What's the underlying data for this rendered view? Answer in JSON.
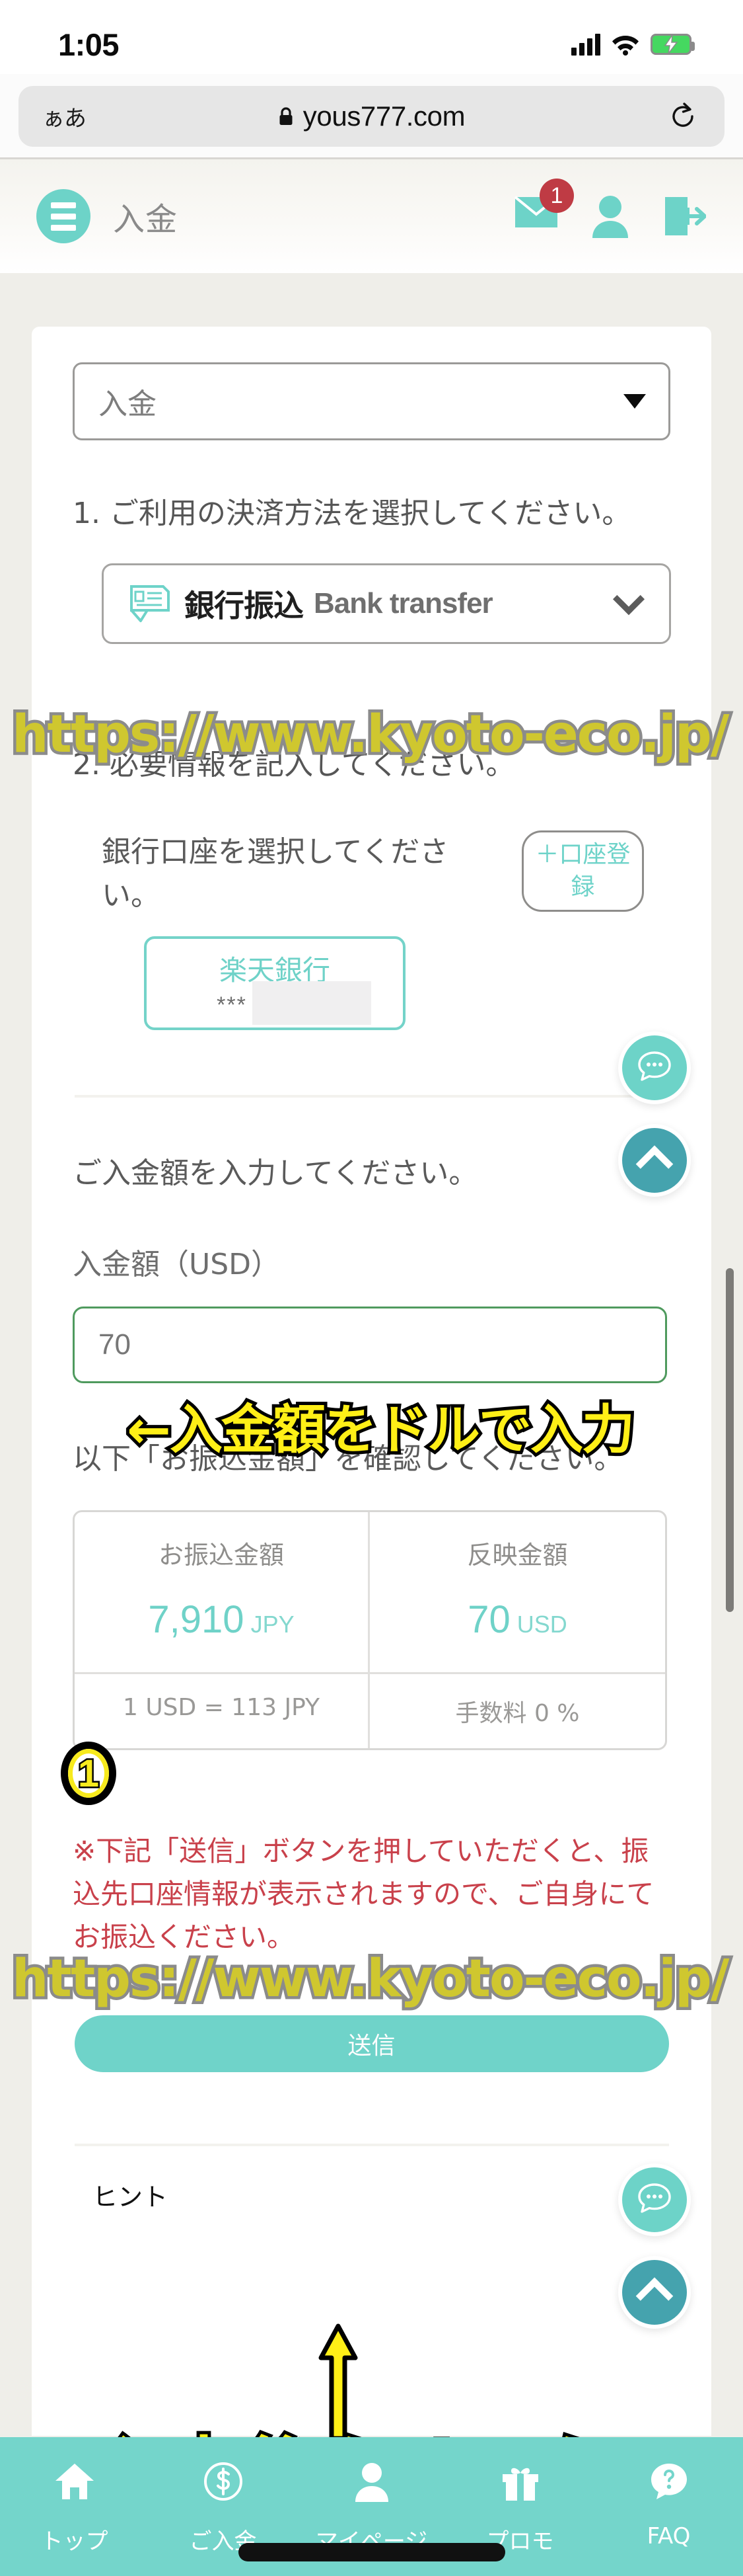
{
  "status_bar": {
    "time": "1:05",
    "signal_icon": "cellular-signal-icon",
    "wifi_icon": "wifi-icon",
    "battery_icon": "battery-charging-icon"
  },
  "browser": {
    "text_size_button": "ぁあ",
    "lock_icon": "lock-icon",
    "url": "yous777.com",
    "reload_icon": "reload-icon"
  },
  "app_header": {
    "menu_icon": "hamburger-menu-icon",
    "title": "入金",
    "mail_icon": "mail-icon",
    "mail_badge": "1",
    "profile_icon": "user-profile-icon",
    "logout_icon": "logout-icon"
  },
  "page": {
    "select_value": "入金",
    "step1_title": "1. ご利用の決済方法を選択してください。",
    "payment_method": {
      "icon": "bank-transfer-icon",
      "label_ja": "銀行振込",
      "label_en": "Bank transfer",
      "chevron_icon": "chevron-down-icon"
    },
    "step2_title": "2. 必要情報を記入してください。",
    "bank_select_label": "銀行口座を選択してください。",
    "register_account_button": "＋口座登録",
    "bank_card": {
      "name": "楽天銀行",
      "masked": "***"
    },
    "amount_prompt": "ご入金額を入力してください。",
    "amount_label": "入金額（USD）",
    "amount_value": "70",
    "confirm_text": "以下「お振込金額」を確認してください。",
    "warning_text": "※下記「送信」ボタンを押していただくと、振込先口座情報が表示されますので、ご自身にてお振込ください。",
    "submit_button": "送信",
    "hint_label": "ヒント"
  },
  "amount_table": {
    "headers": [
      "お振込金額",
      "反映金額"
    ],
    "values": [
      {
        "amount": "7,910",
        "currency": "JPY"
      },
      {
        "amount": "70",
        "currency": "USD"
      }
    ],
    "footer": [
      "1 USD = 113 JPY",
      "手数料 0 %"
    ]
  },
  "floating_buttons": {
    "chat_icon": "chat-bubble-icon",
    "scroll_top_icon": "chevron-up-icon"
  },
  "annotations": {
    "watermark": "https://www.kyoto-eco.jp/",
    "input_note": "←入金額をドルで入力",
    "click_note": "入力後クリック",
    "marker_one": "1",
    "arrow_icon": "up-arrow-icon"
  },
  "bottom_nav": [
    {
      "label": "トップ",
      "icon": "home-icon"
    },
    {
      "label": "ご入金",
      "icon": "dollar-coin-icon"
    },
    {
      "label": "マイページ",
      "icon": "person-icon"
    },
    {
      "label": "プロモ",
      "icon": "gift-icon"
    },
    {
      "label": "FAQ",
      "icon": "question-help-icon"
    }
  ],
  "colors": {
    "brand_teal": "#6fd3c9",
    "nav_teal": "#74d5cb",
    "badge_red": "#bf3b44",
    "warning_red": "#c9414b",
    "annotation_yellow": "#ffef17",
    "watermark_olive": "#cfc72f"
  }
}
